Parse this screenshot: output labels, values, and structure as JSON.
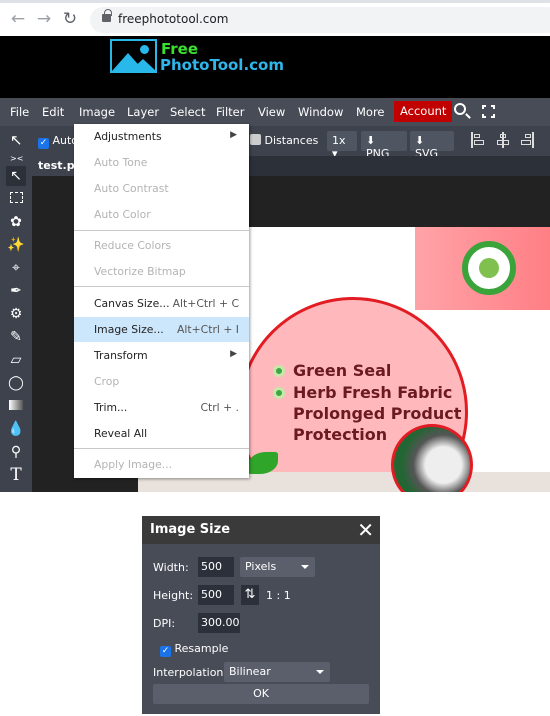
{
  "browser": {
    "url": "freephototool.com",
    "back_icon": "arrow-left-icon",
    "forward_icon": "arrow-right-icon",
    "reload_icon": "reload-icon"
  },
  "logo": {
    "line1": "Free",
    "line2": "PhotoTool.com"
  },
  "menubar": {
    "items": [
      "File",
      "Edit",
      "Image",
      "Layer",
      "Select",
      "Filter",
      "View",
      "Window",
      "More"
    ],
    "account": "Account",
    "account_color": "#c10000"
  },
  "toolbar": {
    "auto_label": "Auto",
    "auto_checked": true,
    "distances_label": "Distances",
    "distances_checked": false,
    "zoom_select": "1x",
    "png_label": "PNG",
    "svg_label": "SVG"
  },
  "document_tab": {
    "name": "test.ps"
  },
  "tools": [
    "move-tool",
    "marquee-tool",
    "lasso-tool",
    "magic-wand-tool",
    "crop-tool",
    "eyedropper-tool",
    "healing-tool",
    "brush-tool",
    "stamp-tool",
    "eraser-tool",
    "gradient-tool",
    "blur-tool",
    "dodge-tool",
    "type-tool"
  ],
  "canvas_art": {
    "features": [
      "Green Seal",
      "Herb Fresh Fabric",
      "Prolonged Product",
      "Protection"
    ]
  },
  "image_menu": {
    "items": [
      {
        "label": "Adjustments",
        "submenu": true,
        "disabled": false
      },
      {
        "label": "Auto Tone",
        "disabled": true
      },
      {
        "label": "Auto Contrast",
        "disabled": true
      },
      {
        "label": "Auto Color",
        "disabled": true
      },
      {
        "label": "Reduce Colors",
        "disabled": true
      },
      {
        "label": "Vectorize Bitmap",
        "disabled": true
      },
      {
        "label": "Canvas Size...",
        "shortcut": "Alt+Ctrl + C",
        "disabled": false
      },
      {
        "label": "Image Size...",
        "shortcut": "Alt+Ctrl + I",
        "disabled": false,
        "highlighted": true
      },
      {
        "label": "Transform",
        "submenu": true,
        "disabled": false
      },
      {
        "label": "Crop",
        "disabled": true
      },
      {
        "label": "Trim...",
        "shortcut": "Ctrl + .",
        "disabled": false
      },
      {
        "label": "Reveal All",
        "disabled": false
      },
      {
        "label": "Apply Image...",
        "disabled": true
      }
    ]
  },
  "image_size_dialog": {
    "title": "Image Size",
    "width_label": "Width:",
    "width_value": "500",
    "unit": "Pixels",
    "height_label": "Height:",
    "height_value": "500",
    "ratio": "1 : 1",
    "dpi_label": "DPI:",
    "dpi_value": "300.000",
    "resample_label": "Resample",
    "resample_checked": true,
    "interpolation_label": "Interpolation:",
    "interpolation_value": "Bilinear",
    "ok_label": "OK"
  }
}
